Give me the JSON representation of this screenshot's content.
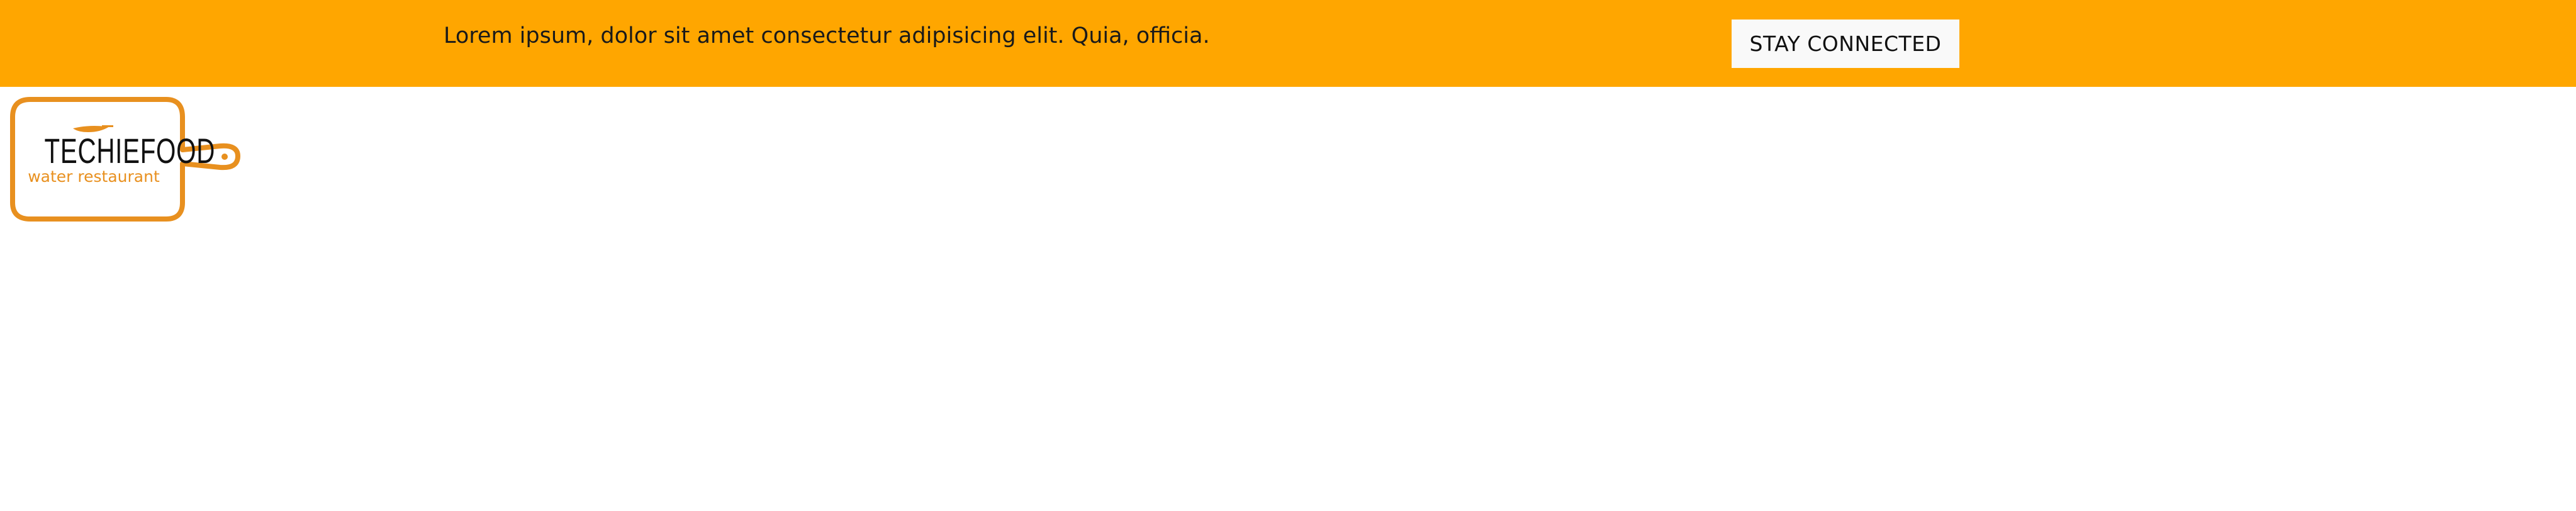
{
  "banner": {
    "message": "Lorem ipsum, dolor sit amet consectetur adipisicing elit. Quia, officia.",
    "button_label": "STAY CONNECTED",
    "background_color": "#ffa600",
    "button_color": "#f9f9f9"
  },
  "logo": {
    "brand_name": "TECHIEFOOD",
    "tagline": "water restaurant",
    "icon": "cutting-board-icon",
    "accent_color": "#e8901f"
  }
}
